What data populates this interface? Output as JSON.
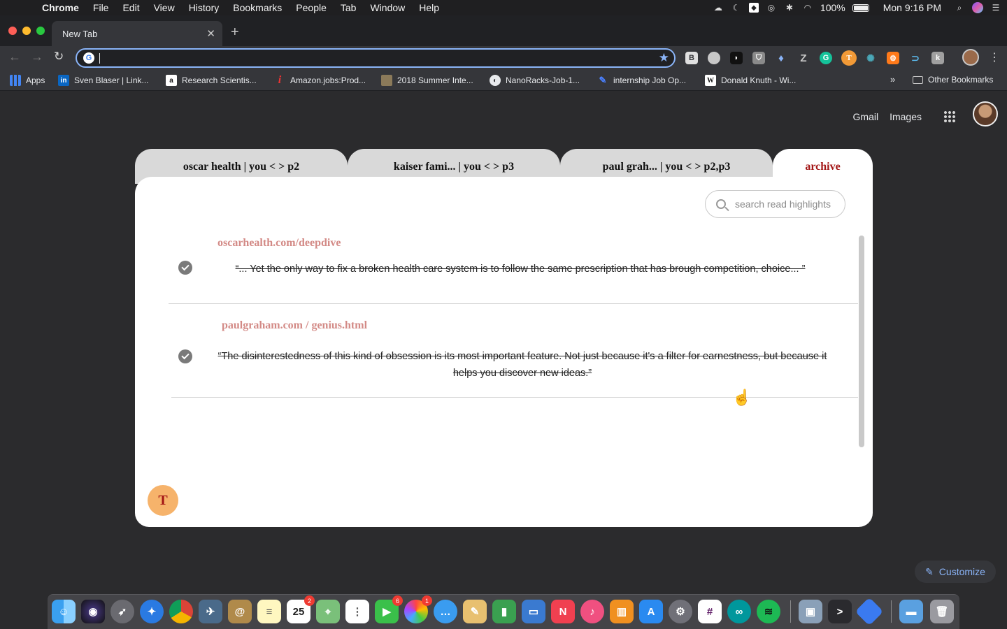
{
  "menubar": {
    "items": [
      "Chrome",
      "File",
      "Edit",
      "View",
      "History",
      "Bookmarks",
      "People",
      "Tab",
      "Window",
      "Help"
    ],
    "battery": "100%",
    "clock": "Mon 9:16 PM"
  },
  "browser": {
    "tab_title": "New Tab",
    "omnibox_value": "",
    "bookmarks": [
      {
        "label": "Apps",
        "icon": "apps-grid-icon"
      },
      {
        "label": "Sven Blaser | Link...",
        "icon": "linkedin-icon"
      },
      {
        "label": "Research Scientis...",
        "icon": "amazon-icon"
      },
      {
        "label": "Amazon.jobs:Prod...",
        "icon": "info-i-icon"
      },
      {
        "label": "2018 Summer Inte...",
        "icon": "image-icon"
      },
      {
        "label": "NanoRacks-Job-1...",
        "icon": "globe-icon"
      },
      {
        "label": "internship Job Op...",
        "icon": "job-icon"
      },
      {
        "label": "Donald Knuth - Wi...",
        "icon": "wikipedia-icon"
      }
    ],
    "bookmarks_more": "»",
    "other_bookmarks": "Other Bookmarks"
  },
  "ntp": {
    "gmail": "Gmail",
    "images": "Images",
    "customize": "Customize"
  },
  "widget": {
    "tabs": [
      {
        "label": "oscar health | you < > p2"
      },
      {
        "label": "kaiser fami... | you < > p3"
      },
      {
        "label": "paul grah... | you < > p2,p3"
      },
      {
        "label": "archive"
      }
    ],
    "search_placeholder": "search read highlights",
    "entries": [
      {
        "source": "oscarhealth.com/deepdive",
        "quote": "“... Yet the only way to fix a broken health care system is to follow the same prescription that has brough competition, choice... ”"
      },
      {
        "source": "paulgraham.com / genius.html",
        "quote": "“The disinterestedness of this kind of obsession is its most important feature. Not just because it's a filter for earnestness, but because it helps you discover new ideas.”"
      }
    ],
    "user_initial": "T"
  },
  "colors": {
    "accent_archive": "#a31515",
    "source_link": "#d38a86",
    "avatar_bg": "#f6b36b"
  }
}
